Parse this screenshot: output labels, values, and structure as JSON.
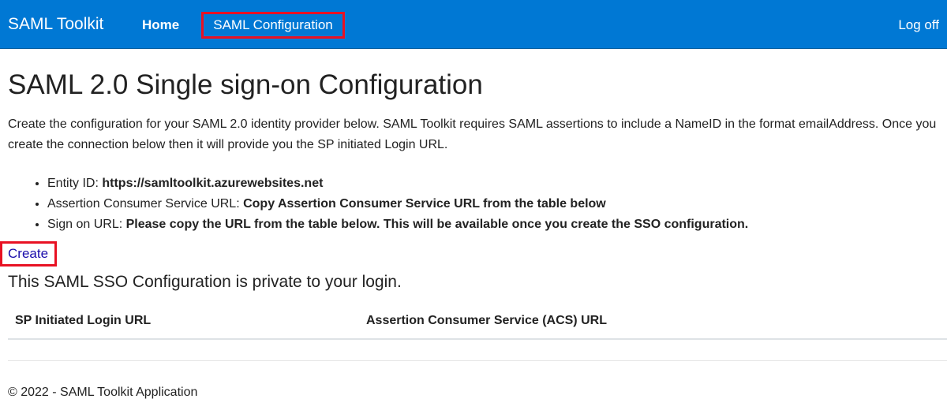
{
  "navbar": {
    "brand": "SAML Toolkit",
    "home": "Home",
    "saml_configuration": "SAML Configuration",
    "log_off": "Log off",
    "background_color": "#0078d4",
    "highlight_color": "#e81123"
  },
  "main": {
    "title": "SAML 2.0 Single sign-on Configuration",
    "intro": "Create the configuration for your SAML 2.0 identity provider below. SAML Toolkit requires SAML assertions to include a NameID in the format emailAddress. Once you create the connection below then it will provide you the SP initiated Login URL.",
    "details": [
      {
        "label": "Entity ID: ",
        "value": "https://samltoolkit.azurewebsites.net"
      },
      {
        "label": "Assertion Consumer Service URL: ",
        "value": "Copy Assertion Consumer Service URL from the table below"
      },
      {
        "label": "Sign on URL: ",
        "value": "Please copy the URL from the table below. This will be available once you create the SSO configuration."
      }
    ],
    "create_link": "Create",
    "private_note": "This SAML SSO Configuration is private to your login.",
    "table": {
      "headers": [
        "SP Initiated Login URL",
        "Assertion Consumer Service (ACS) URL"
      ],
      "rows": []
    }
  },
  "footer": {
    "text": "© 2022 - SAML Toolkit Application"
  }
}
